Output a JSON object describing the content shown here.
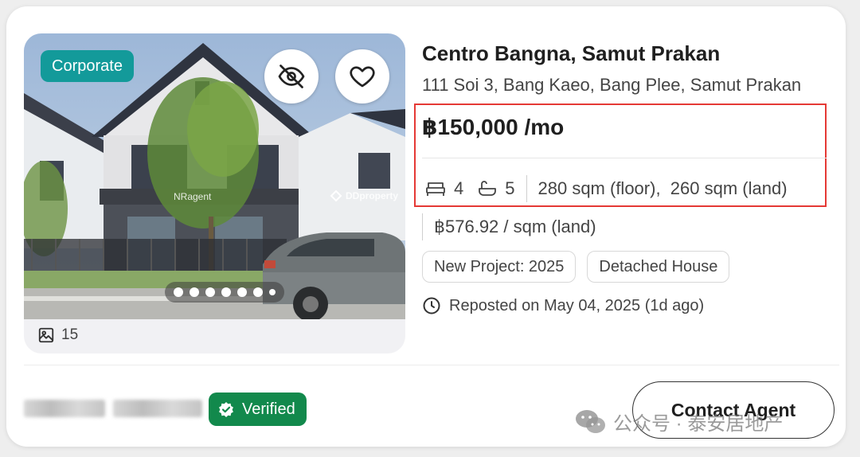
{
  "listing": {
    "badge": "Corporate",
    "photo_watermark_agent": "NRagent",
    "photo_watermark_brand": "DDproperty",
    "photo_count": "15",
    "carousel_dots": 7,
    "title": "Centro Bangna, Samut Prakan",
    "address": "111 Soi 3, Bang Kaeo, Bang Plee, Samut Prakan",
    "price": "฿150,000 /mo",
    "bedrooms": "4",
    "bathrooms": "5",
    "area": "280 sqm (floor),  260 sqm (land)",
    "price_per_sqm": "฿576.92 / sqm (land)",
    "tags": [
      "New Project: 2025",
      "Detached House"
    ],
    "reposted": "Reposted on May 04, 2025 (1d ago)"
  },
  "agent": {
    "verified_label": "Verified",
    "contact_label": "Contact Agent"
  },
  "watermark": {
    "text": "公众号 · 泰安居地产"
  },
  "icons": {
    "hide": "eye-off-icon",
    "favorite": "heart-icon",
    "bed": "bed-icon",
    "bath": "bath-icon",
    "gallery": "image-icon",
    "clock": "clock-icon",
    "verified": "shield-check-icon"
  },
  "colors": {
    "corporate_badge": "#139a9a",
    "verified_badge": "#12894c",
    "highlight_border": "#e53935"
  }
}
